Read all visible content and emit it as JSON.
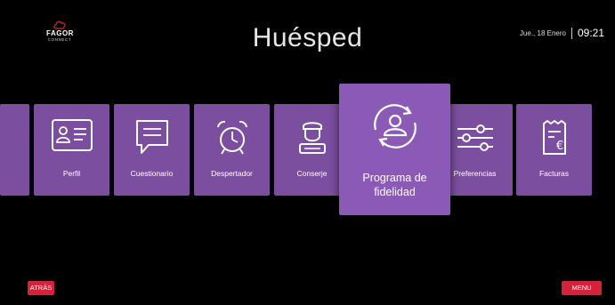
{
  "brand": {
    "name": "FAGOR",
    "sub": "CONNECT"
  },
  "header": {
    "title": "Huésped",
    "date": "Jue., 18 Enero",
    "time": "09:21"
  },
  "tiles": [
    {
      "label": "",
      "icon": "partial-tile"
    },
    {
      "label": "Perfil",
      "icon": "id-card-icon"
    },
    {
      "label": "Cuestionario",
      "icon": "speech-bubble-icon"
    },
    {
      "label": "Despertador",
      "icon": "alarm-clock-icon"
    },
    {
      "label": "Conserje",
      "icon": "concierge-icon"
    },
    {
      "label": "Programa de fidelidad",
      "icon": "loyalty-user-cycle-icon",
      "focused": true
    },
    {
      "label": "Preferencias",
      "icon": "sliders-icon"
    },
    {
      "label": "Facturas",
      "icon": "invoice-euro-icon"
    }
  ],
  "footer": {
    "back_label": "ATRÁS",
    "menu_label": "MENU"
  },
  "colors": {
    "tile": "#7b4ea0",
    "tile_focused": "#8a5ab6",
    "button": "#d4223b",
    "background": "#000000"
  }
}
